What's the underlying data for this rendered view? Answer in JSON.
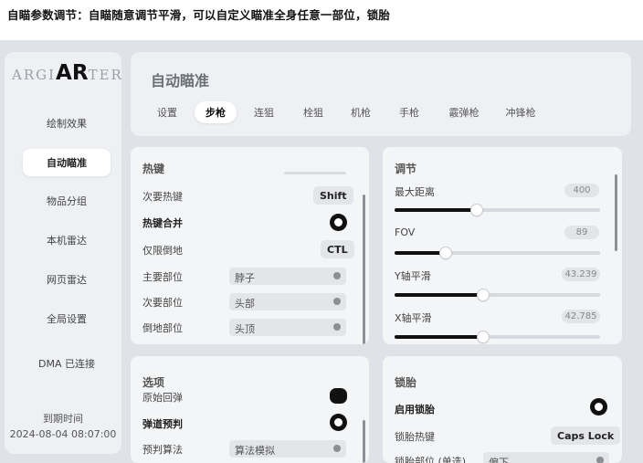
{
  "caption": "自瞄参数调节：自瞄随意调节平滑，可以自定义瞄准全身任意一部位，锁胎",
  "logo": {
    "left": "ARGI",
    "mid": "AR",
    "right": "TER"
  },
  "sidebar": {
    "items": [
      {
        "label": "绘制效果",
        "active": false
      },
      {
        "label": "自动瞄准",
        "active": true
      },
      {
        "label": "物品分组",
        "active": false
      },
      {
        "label": "本机雷达",
        "active": false
      },
      {
        "label": "网页雷达",
        "active": false
      },
      {
        "label": "全局设置",
        "active": false
      },
      {
        "label": "DMA 已连接",
        "active": false
      }
    ],
    "expire_label": "到期时间",
    "expire_value": "2024-08-04 08:07:00"
  },
  "header": {
    "title": "自动瞄准",
    "tabs": [
      {
        "label": "设置"
      },
      {
        "label": "步枪",
        "active": true
      },
      {
        "label": "连狙"
      },
      {
        "label": "栓狙"
      },
      {
        "label": "机枪"
      },
      {
        "label": "手枪"
      },
      {
        "label": "霰弹枪"
      },
      {
        "label": "冲锋枪"
      }
    ]
  },
  "hotkey_panel": {
    "title": "热键",
    "secondary_hotkey_label": "次要热键",
    "secondary_hotkey_value": "Shift",
    "merge_label": "热键合并",
    "knocked_label": "仅限倒地",
    "knocked_value": "CTL",
    "primary_part_label": "主要部位",
    "primary_part_value": "脖子",
    "secondary_part_label": "次要部位",
    "secondary_part_value": "头部",
    "knocked_part_label": "倒地部位",
    "knocked_part_value": "头顶"
  },
  "adjust_panel": {
    "title": "调节",
    "sliders": [
      {
        "label": "最大距离",
        "value": "400",
        "fraction": 0.4
      },
      {
        "label": "FOV",
        "value": "89",
        "fraction": 0.25
      },
      {
        "label": "Y轴平滑",
        "value": "43.239",
        "fraction": 0.43
      },
      {
        "label": "X轴平滑",
        "value": "42.785",
        "fraction": 0.43
      }
    ]
  },
  "options_panel": {
    "title": "选项",
    "raw_recoil_label": "原始回弹",
    "ballistic_label": "弹道预判",
    "predict_label": "预判算法",
    "predict_value": "算法模拟"
  },
  "tire_panel": {
    "title": "锁胎",
    "enable_label": "启用锁胎",
    "hotkey_label": "锁胎热键",
    "hotkey_value": "Caps Lock",
    "part_label": "锁胎部位 (单选)",
    "part_value": "偏下"
  }
}
